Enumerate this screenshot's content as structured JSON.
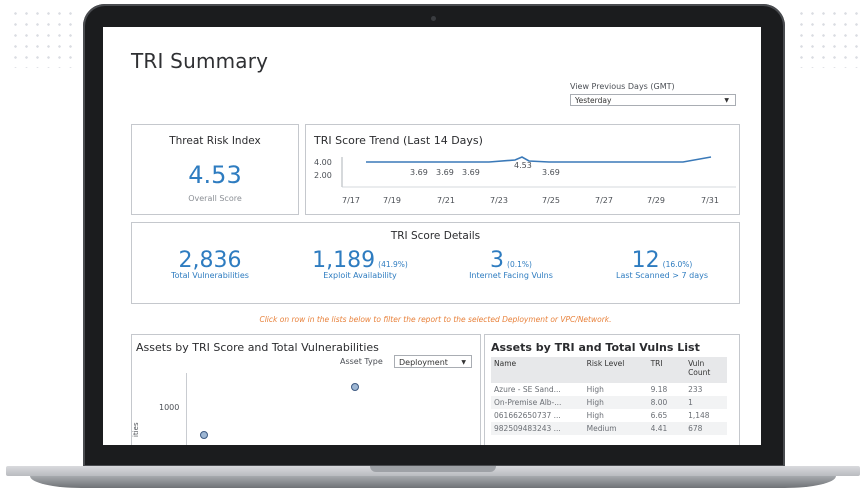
{
  "header": {
    "title": "TRI Summary"
  },
  "period": {
    "label": "View Previous Days (GMT)",
    "selected": "Yesterday"
  },
  "threat_risk_index": {
    "title": "Threat Risk Index",
    "value": "4.53",
    "label": "Overall Score"
  },
  "trend": {
    "title": "TRI Score Trend (Last 14 Days)",
    "y_ticks": [
      "4.00",
      "2.00"
    ],
    "x_ticks": [
      "7/17",
      "7/19",
      "7/21",
      "7/23",
      "7/25",
      "7/27",
      "7/29",
      "7/31"
    ],
    "point_labels": [
      "3.69",
      "3.69",
      "3.69",
      "4.53",
      "3.69"
    ]
  },
  "details": {
    "title": "TRI Score Details",
    "metrics": [
      {
        "value": "2,836",
        "pct": "",
        "label": "Total Vulnerabilities"
      },
      {
        "value": "1,189",
        "pct": "(41.9%)",
        "label": "Exploit Availability"
      },
      {
        "value": "3",
        "pct": "(0.1%)",
        "label": "Internet Facing Vulns"
      },
      {
        "value": "12",
        "pct": "(16.0%)",
        "label": "Last Scanned > 7 days"
      }
    ]
  },
  "hint": "Click on row in the lists below to filter the report to the selected Deployment or VPC/Network.",
  "assets_chart": {
    "title": "Assets by TRI Score and Total Vulnerabilities",
    "asset_type_label": "Asset Type",
    "asset_type_value": "Deployment",
    "y_tick": "1000",
    "y_axis_label": "ities"
  },
  "vuln_list": {
    "title": "Assets by TRI and Total Vulns List",
    "columns": [
      "Name",
      "Risk Level",
      "TRI",
      "Vuln Count"
    ],
    "rows": [
      [
        "Azure - SE Sand...",
        "High",
        "9.18",
        "233"
      ],
      [
        "On-Premise Alb-...",
        "High",
        "8.00",
        "1"
      ],
      [
        "061662650737 ...",
        "High",
        "6.65",
        "1,148"
      ],
      [
        "982509483243 ...",
        "Medium",
        "4.41",
        "678"
      ]
    ]
  },
  "colors": {
    "accent": "#2e7cc0",
    "hint": "#e8823c",
    "bezel": "#1b1c1e"
  }
}
